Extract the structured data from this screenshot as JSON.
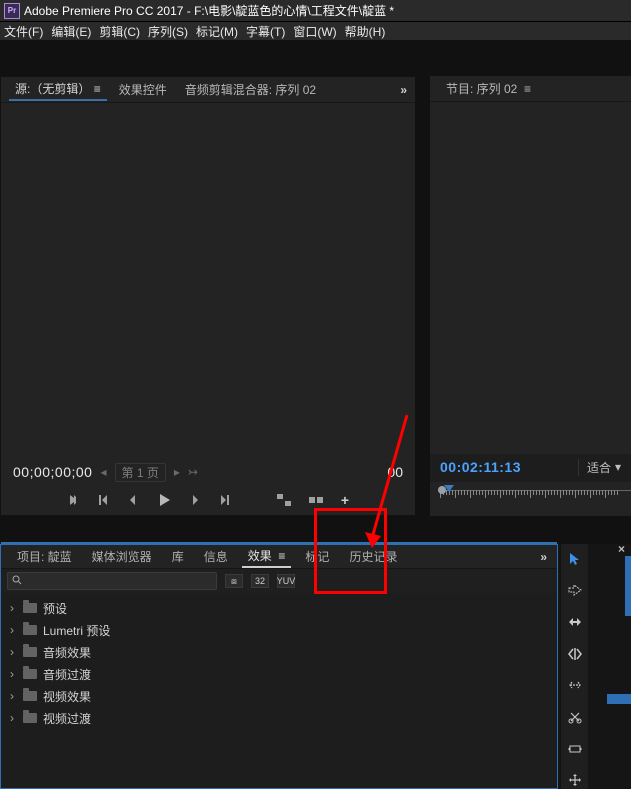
{
  "titlebar": {
    "title": "Adobe Premiere Pro CC 2017 - F:\\电影\\靛蓝色的心情\\工程文件\\靛蓝 *",
    "app_abbrev": "Pr"
  },
  "menubar": {
    "items": [
      "文件(F)",
      "编辑(E)",
      "剪辑(C)",
      "序列(S)",
      "标记(M)",
      "字幕(T)",
      "窗口(W)",
      "帮助(H)"
    ]
  },
  "source_panel": {
    "tabs": [
      "源:（无剪辑）",
      "效果控件",
      "音频剪辑混合器: 序列 02"
    ],
    "menu_glyph": "≡",
    "more_glyph": "»",
    "timecode_left": "00;00;00;00",
    "page_info": "第 1 页",
    "timecode_right": "00"
  },
  "program_panel": {
    "tabs": [
      "节目: 序列 02"
    ],
    "menu_glyph": "≡",
    "timecode": "00:02:11:13",
    "fit_label": "适合",
    "dropdown_glyph": "▾"
  },
  "effects_panel": {
    "tabs": [
      "项目: 靛蓝",
      "媒体浏览器",
      "库",
      "信息",
      "效果",
      "标记",
      "历史记录"
    ],
    "active_tab_index": 4,
    "menu_glyph": "≡",
    "more_glyph": "»",
    "search_placeholder": "",
    "toggle_icons": [
      "⧈",
      "32",
      "YUV"
    ],
    "tree_items": [
      "预设",
      "Lumetri 预设",
      "音频效果",
      "音频过渡",
      "视频效果",
      "视频过渡"
    ],
    "expand_glyph": "›"
  },
  "tool_column": {
    "tools": [
      "selection",
      "track-select",
      "ripple-edit",
      "rolling-edit",
      "rate-stretch",
      "razor",
      "slip",
      "slide",
      "pen",
      "hand"
    ]
  },
  "colors": {
    "accent_blue": "#2f6fb5",
    "red": "#ff0000",
    "tc_blue": "#4aa3ff"
  }
}
